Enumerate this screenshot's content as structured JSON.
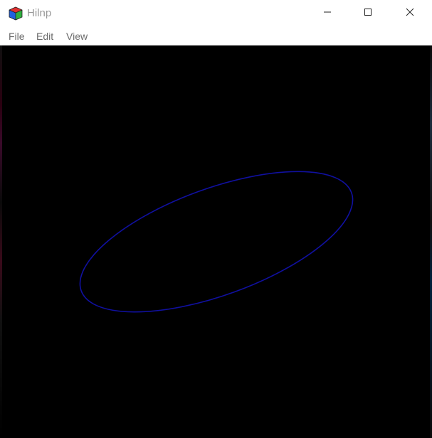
{
  "window": {
    "title": "Hilnp",
    "app_icon": "cube-icon",
    "controls": {
      "minimize_icon": "minimize-icon",
      "maximize_icon": "maximize-icon",
      "close_icon": "close-icon"
    }
  },
  "menubar": {
    "items": [
      {
        "label": "File"
      },
      {
        "label": "Edit"
      },
      {
        "label": "View"
      }
    ]
  },
  "canvas": {
    "background": "#000000",
    "shape": "ellipse",
    "stroke_color": "#1010a0"
  }
}
